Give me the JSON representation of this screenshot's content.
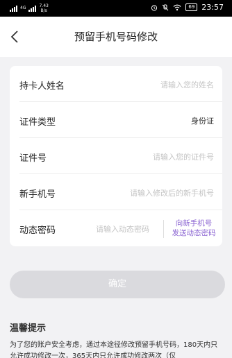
{
  "status_bar": {
    "network": "4G",
    "speed_value": "7.43",
    "speed_unit": "B/s",
    "battery": "69",
    "time": "23:57"
  },
  "header": {
    "title": "预留手机号码修改"
  },
  "form": {
    "name_label": "持卡人姓名",
    "name_placeholder": "请输入您的姓名",
    "id_type_label": "证件类型",
    "id_type_value": "身份证",
    "id_number_label": "证件号",
    "id_number_placeholder": "请输入您的证件号",
    "phone_label": "新手机号",
    "phone_placeholder": "请输入修改后的新手机号",
    "otp_label": "动态密码",
    "otp_placeholder": "请输入动态密码",
    "otp_button_line1": "向新手机号",
    "otp_button_line2": "发送动态密码"
  },
  "confirm_label": "确定",
  "tips": {
    "title": "温馨提示",
    "text": "为了您的账户安全考虑，通过本途径修改预留手机号码，180天内只允许成功修改一次，365天内只允许成功修改两次（仅"
  },
  "icons": {
    "back": "chevron-left-icon",
    "alarm": "alarm-icon",
    "mute": "mute-icon",
    "wifi": "wifi-icon",
    "battery": "battery-icon"
  }
}
